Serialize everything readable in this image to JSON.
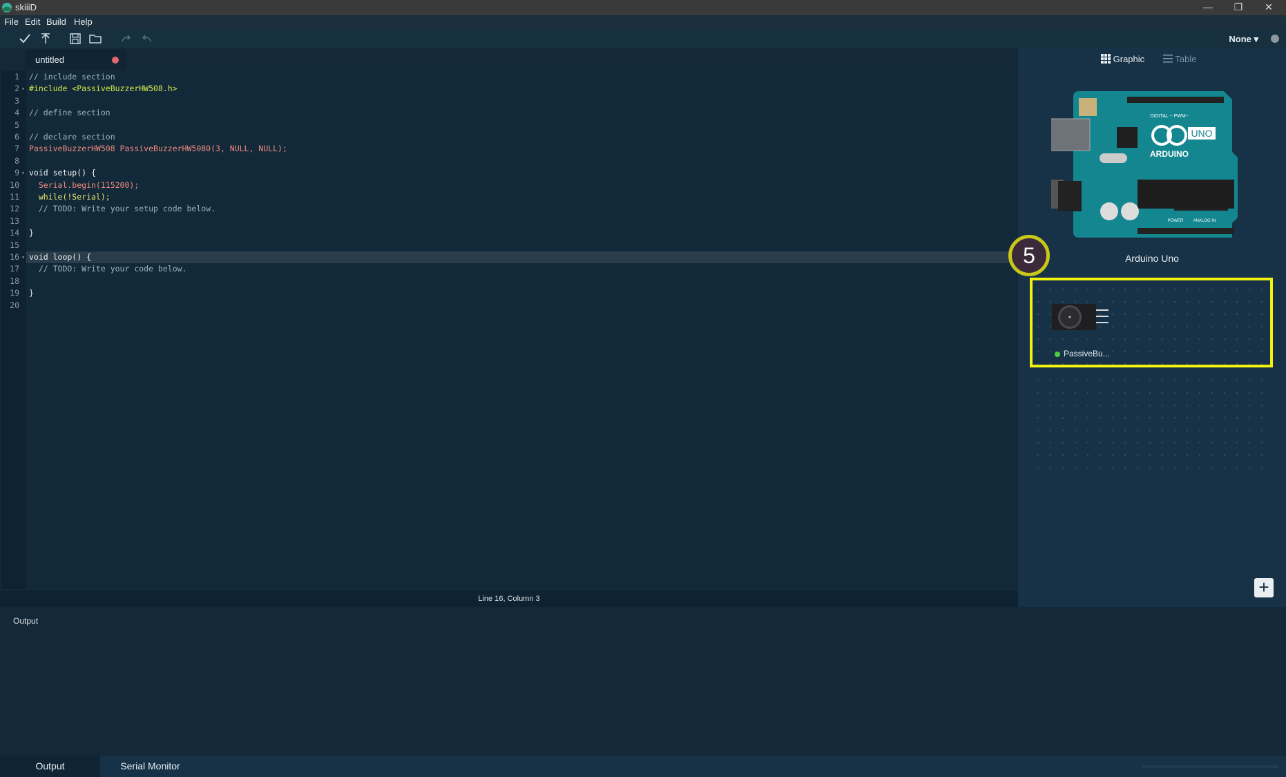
{
  "window": {
    "title": "skiiiD",
    "minimize": "—",
    "restore": "❐",
    "close": "✕"
  },
  "menu": [
    "File",
    "Edit",
    "Build",
    "Help"
  ],
  "toolbar": {
    "verify_icon": "check-icon",
    "upload_icon": "upload-arrow-icon",
    "save_icon": "save-icon",
    "open_icon": "folder-icon",
    "redo_icon": "redo-icon",
    "undo_icon": "undo-icon",
    "board_select": "None ▾"
  },
  "editor": {
    "tab_name": "untitled",
    "unsaved_color": "#e0666e",
    "lines": [
      {
        "n": "1",
        "text": "// include section",
        "type": "comment"
      },
      {
        "n": "2",
        "text": "#include <PassiveBuzzerHW508.h>",
        "type": "pre",
        "fold": true
      },
      {
        "n": "3",
        "text": "",
        "type": "plain"
      },
      {
        "n": "4",
        "text": "// define section",
        "type": "comment"
      },
      {
        "n": "5",
        "text": "",
        "type": "plain"
      },
      {
        "n": "6",
        "text": "// declare section",
        "type": "comment"
      },
      {
        "n": "7",
        "text": "PassiveBuzzerHW508 PassiveBuzzerHW5080(3, NULL, NULL);",
        "type": "decl"
      },
      {
        "n": "8",
        "text": "",
        "type": "plain"
      },
      {
        "n": "9",
        "text": "void setup() {",
        "type": "func",
        "fold": true
      },
      {
        "n": "10",
        "text": "  Serial.begin(115200);",
        "type": "serialbegin"
      },
      {
        "n": "11",
        "text": "  while(!Serial);",
        "type": "while"
      },
      {
        "n": "12",
        "text": "  // TODO: Write your setup code below.",
        "type": "comment"
      },
      {
        "n": "13",
        "text": "",
        "type": "plain"
      },
      {
        "n": "14",
        "text": "}",
        "type": "plain"
      },
      {
        "n": "15",
        "text": "",
        "type": "plain"
      },
      {
        "n": "16",
        "text": "void loop() {",
        "type": "func",
        "fold": true,
        "active": true
      },
      {
        "n": "17",
        "text": "  // TODO: Write your code below.",
        "type": "comment"
      },
      {
        "n": "18",
        "text": "",
        "type": "plain"
      },
      {
        "n": "19",
        "text": "}",
        "type": "plain"
      },
      {
        "n": "20",
        "text": "",
        "type": "plain"
      }
    ],
    "status": "Line 16, Column 3"
  },
  "panel": {
    "view_graphic": "Graphic",
    "view_table": "Table",
    "board_name": "Arduino Uno",
    "board_text_uno": "UNO",
    "board_text_arduino": "ARDUINO",
    "board_text_digital": "DIGITAL ~ PWM~",
    "board_text_power": "POWER",
    "board_text_analog": "ANALOG IN",
    "module_label": "PassiveBu...",
    "step_number": "5",
    "add_label": "+"
  },
  "output": {
    "title": "Output"
  },
  "bottom_tabs": [
    "Output",
    "Serial Monitor"
  ]
}
